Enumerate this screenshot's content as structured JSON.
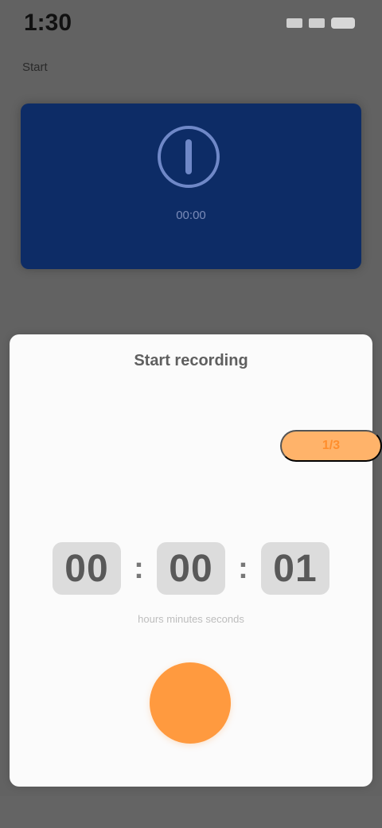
{
  "status_bar": {
    "time": "1:30"
  },
  "page": {
    "label": "Start"
  },
  "hero": {
    "caption": "00:00"
  },
  "sheet": {
    "title": "Start recording",
    "badge": "1/3",
    "timer": {
      "hours": "00",
      "minutes": "00",
      "seconds": "01"
    },
    "timer_hint": "hours minutes seconds",
    "primary_action": "Record"
  },
  "colors": {
    "accent": "#ff9a3f",
    "hero": "#0d2c66"
  }
}
